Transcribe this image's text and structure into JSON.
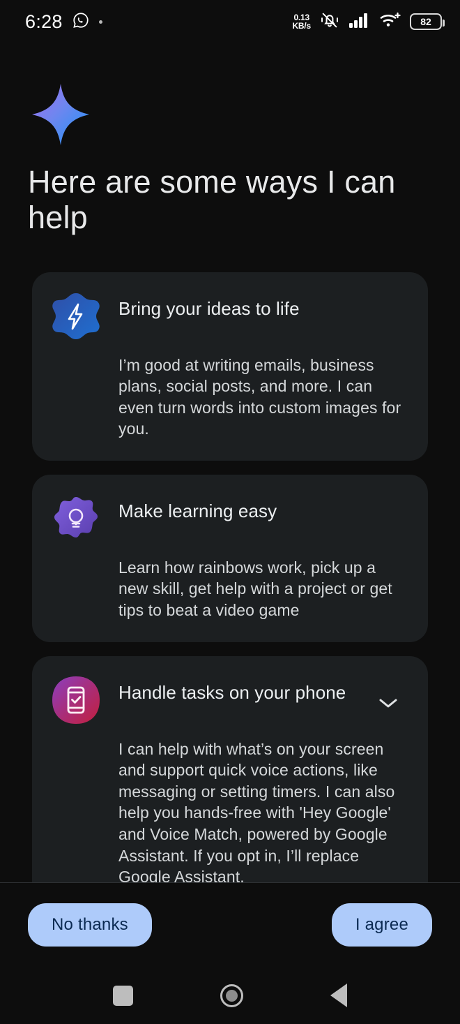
{
  "status_bar": {
    "time": "6:28",
    "whatsapp_icon": "whatsapp-icon",
    "notification_dot": "notification-dot",
    "net_speed_value": "0.13",
    "net_speed_unit": "KB/s",
    "vibrate_icon": "ringer-vibrate-off-icon",
    "signal_icon": "cellular-signal-icon",
    "wifi_icon": "wifi-plus-icon",
    "battery_level": "82"
  },
  "brand": {
    "logo": "gemini-sparkle-icon",
    "gradient_from": "#a06cf0",
    "gradient_to": "#1e93f5"
  },
  "headline": "Here are some ways I can help",
  "cards": [
    {
      "icon": "lightning-bolt-icon",
      "icon_shape": "blob",
      "icon_color_from": "#2f4fa8",
      "icon_color_to": "#1f6fd0",
      "title": "Bring your ideas to life",
      "body": "I’m good at writing emails, business plans, social posts, and more. I can even turn words into custom images for you.",
      "expandable": false
    },
    {
      "icon": "lightbulb-icon",
      "icon_shape": "flower",
      "icon_color_from": "#7b55d6",
      "icon_color_to": "#5c3fb0",
      "title": "Make learning easy",
      "body": "Learn how rainbows work, pick up a new skill, get help with a project or get tips to beat a video game",
      "expandable": false
    },
    {
      "icon": "phone-check-icon",
      "icon_shape": "squircle",
      "icon_color_from": "#8b3fbf",
      "icon_color_to": "#c2203f",
      "title": "Handle tasks on your phone",
      "body": "I can help with what’s on your screen and support quick voice actions, like messaging or setting timers. I can also help you hands-free with 'Hey Google' and Voice Match, powered by Google Assistant. If you opt in, I’ll replace Google Assistant.",
      "expandable": true,
      "expand_icon": "chevron-down-icon"
    }
  ],
  "actions": {
    "decline_label": "No thanks",
    "accept_label": "I agree",
    "button_bg": "#aecbfa",
    "button_text_color": "#0b2a52"
  },
  "nav_bar": {
    "recents": "recents-square-icon",
    "home": "home-circle-icon",
    "back": "back-triangle-icon"
  },
  "theme": {
    "page_bg": "#0d0d0d",
    "card_bg": "#1c1f21",
    "text_primary": "#e8e9ea",
    "text_secondary": "#d5d8da"
  }
}
